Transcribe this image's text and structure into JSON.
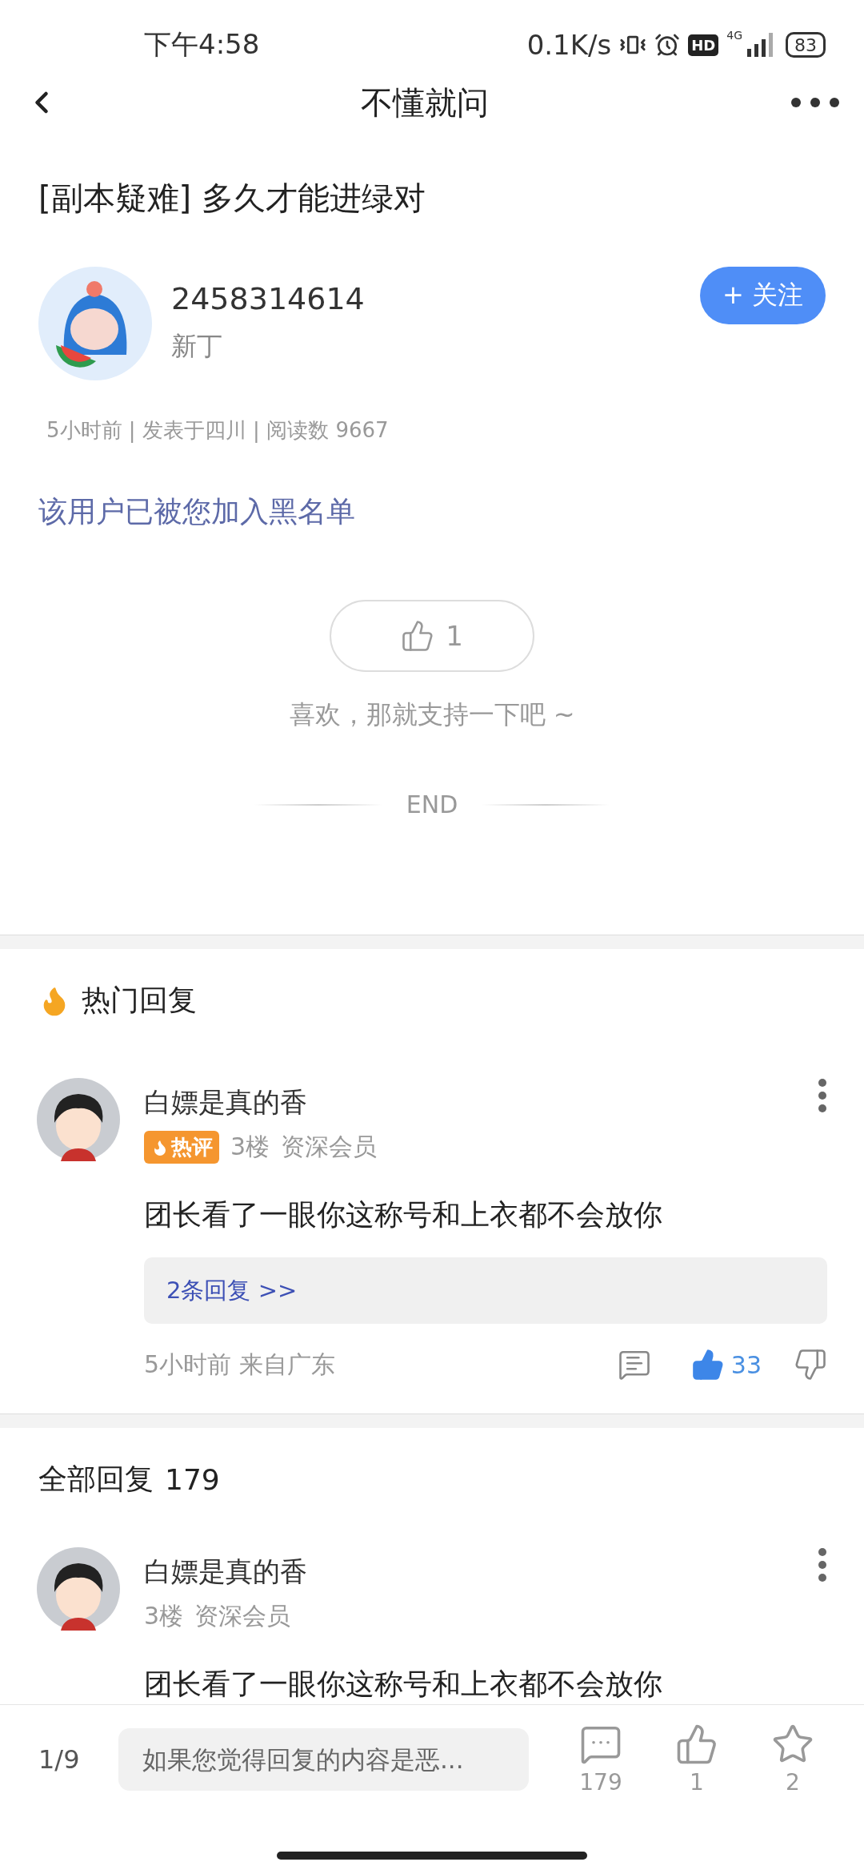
{
  "status_bar": {
    "time": "下午4:58",
    "network_speed": "0.1K/s",
    "network_type": "4G",
    "hd_label": "HD",
    "battery": "83"
  },
  "header": {
    "title": "不懂就问"
  },
  "post": {
    "title": "[副本疑难] 多久才能进绿对",
    "author": {
      "name": "2458314614",
      "level": "新丁"
    },
    "follow_button": "+ 关注",
    "meta": "5小时前 | 发表于四川 | 阅读数 9667",
    "notice": "该用户已被您加入黑名单"
  },
  "like": {
    "count": "1",
    "prompt": "喜欢，那就支持一下吧 ~"
  },
  "end_label": "END",
  "hot_replies": {
    "title": "热门回复",
    "comments": [
      {
        "name": "白嫖是真的香",
        "badge": "热评",
        "floor": "3楼",
        "rank": "资深会员",
        "text": "团长看了一眼你这称号和上衣都不会放你",
        "replies_link": "2条回复 >>",
        "time_location": "5小时前 来自广东",
        "likes": "33",
        "liked": true
      }
    ]
  },
  "all_replies": {
    "title": "全部回复",
    "count": "179",
    "comments": [
      {
        "name": "白嫖是真的香",
        "floor": "3楼",
        "rank": "资深会员",
        "text": "团长看了一眼你这称号和上衣都不会放你"
      }
    ]
  },
  "bottom_bar": {
    "page": "1/9",
    "input_placeholder": "如果您觉得回复的内容是恶...",
    "comment_count": "179",
    "like_count": "1",
    "favorite_count": "2"
  }
}
